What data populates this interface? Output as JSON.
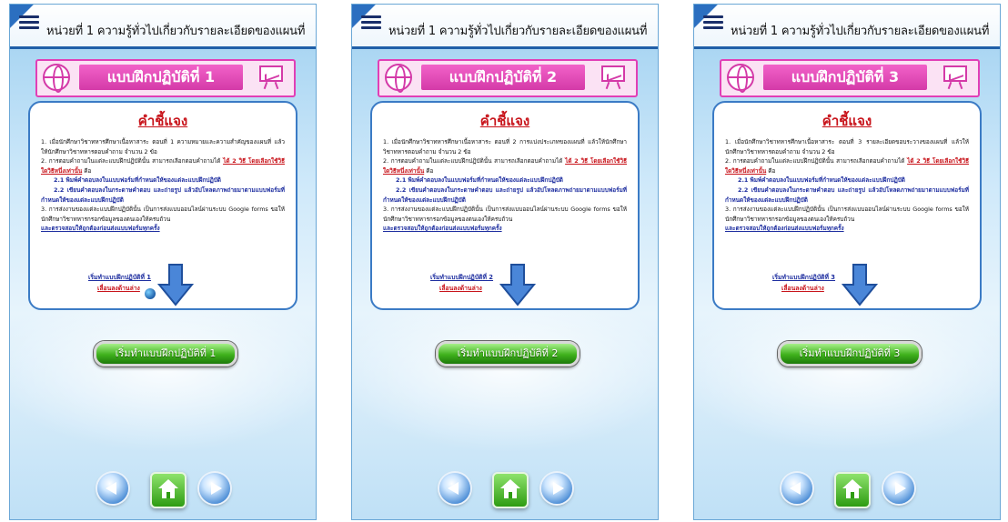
{
  "screens": [
    {
      "unit_title": "หน่วยที่ 1 ความรู้ทั่วไปเกี่ยวกับรายละเอียดของแผนที่",
      "exercise_title": "แบบฝึกปฏิบัติที่ 1",
      "heading": "คำชี้แจง",
      "para1": "1. เมื่อนักศึกษาวิชาทหารศึกษาเนื้อหาสาระ ตอนที่ 1 ความหมายและความสำคัญของแผนที่ แล้วให้นักศึกษาวิชาทหารตอบคำถาม จำนวน 2 ข้อ",
      "para2_pre": "2. การตอบคำถามในแต่ละแบบฝึกปฏิบัตินั้น สามารถเลือกตอบคำถามได้",
      "para2_red": "ได้ 2 วิธี โดยเลือกใช้วิธีใดวิธีหนึ่งเท่านั้น",
      "para2_post": "คือ",
      "item21": "2.1 พิมพ์คำตอบลงในแบบฟอร์มที่กำหนดให้ของแต่ละแบบฝึกปฏิบัติ",
      "item22": "2.2 เขียนคำตอบลงในกระดาษคำตอบ และถ่ายรูป แล้วอัปโหลดภาพถ่ายมาตามแบบฟอร์มที่กำหนดให้ของแต่ละแบบฝึกปฏิบัติ",
      "para3": "3. การส่งงานของแต่ละแบบฝึกปฏิบัตินั้น เป็นการส่งแบบออนไลน์ผ่านระบบ Google forms ขอให้นักศึกษาวิชาทหารกรอกข้อมูลของตนเองให้ครบถ้วน",
      "para3_tail": "และตรวจสอบให้ถูกต้องก่อนส่งแบบฟอร์มทุกครั้ง",
      "start_link": "เริ่มทำแบบฝึกปฏิบัติที่ 1",
      "scroll_hint": "เลื่อนลงด้านล่าง",
      "start_button": "เริ่มทำแบบฝึกปฏิบัติที่ 1"
    },
    {
      "unit_title": "หน่วยที่ 1 ความรู้ทั่วไปเกี่ยวกับรายละเอียดของแผนที่",
      "exercise_title": "แบบฝึกปฏิบัติที่ 2",
      "heading": "คำชี้แจง",
      "para1": "1. เมื่อนักศึกษาวิชาทหารศึกษาเนื้อหาสาระ ตอนที่ 2 การแบ่งประเภทของแผนที่ แล้วให้นักศึกษาวิชาทหารตอบคำถาม จำนวน 2 ข้อ",
      "para2_pre": "2. การตอบคำถามในแต่ละแบบฝึกปฏิบัตินั้น สามารถเลือกตอบคำถามได้",
      "para2_red": "ได้ 2 วิธี โดยเลือกใช้วิธีใดวิธีหนึ่งเท่านั้น",
      "para2_post": "คือ",
      "item21": "2.1 พิมพ์คำตอบลงในแบบฟอร์มที่กำหนดให้ของแต่ละแบบฝึกปฏิบัติ",
      "item22": "2.2 เขียนคำตอบลงในกระดาษคำตอบ และถ่ายรูป แล้วอัปโหลดภาพถ่ายมาตามแบบฟอร์มที่กำหนดให้ของแต่ละแบบฝึกปฏิบัติ",
      "para3": "3. การส่งงานของแต่ละแบบฝึกปฏิบัตินั้น เป็นการส่งแบบออนไลน์ผ่านระบบ Google forms ขอให้นักศึกษาวิชาทหารกรอกข้อมูลของตนเองให้ครบถ้วน",
      "para3_tail": "และตรวจสอบให้ถูกต้องก่อนส่งแบบฟอร์มทุกครั้ง",
      "start_link": "เริ่มทำแบบฝึกปฏิบัติที่ 2",
      "scroll_hint": "เลื่อนลงด้านล่าง",
      "start_button": "เริ่มทำแบบฝึกปฏิบัติที่ 2"
    },
    {
      "unit_title": "หน่วยที่ 1 ความรู้ทั่วไปเกี่ยวกับรายละเอียดของแผนที่",
      "exercise_title": "แบบฝึกปฏิบัติที่ 3",
      "heading": "คำชี้แจง",
      "para1": "1. เมื่อนักศึกษาวิชาทหารศึกษาเนื้อหาสาระ ตอนที่ 3 รายละเอียดขอบระวางของแผนที่ แล้วให้นักศึกษาวิชาทหารตอบคำถาม จำนวน 2 ข้อ",
      "para2_pre": "2. การตอบคำถามในแต่ละแบบฝึกปฏิบัตินั้น สามารถเลือกตอบคำถามได้",
      "para2_red": "ได้ 2 วิธี โดยเลือกใช้วิธีใดวิธีหนึ่งเท่านั้น",
      "para2_post": "คือ",
      "item21": "2.1 พิมพ์คำตอบลงในแบบฟอร์มที่กำหนดให้ของแต่ละแบบฝึกปฏิบัติ",
      "item22": "2.2 เขียนคำตอบลงในกระดาษคำตอบ และถ่ายรูป แล้วอัปโหลดภาพถ่ายมาตามแบบฟอร์มที่กำหนดให้ของแต่ละแบบฝึกปฏิบัติ",
      "para3": "3. การส่งงานของแต่ละแบบฝึกปฏิบัตินั้น เป็นการส่งแบบออนไลน์ผ่านระบบ Google forms ขอให้นักศึกษาวิชาทหารกรอกข้อมูลของตนเองให้ครบถ้วน",
      "para3_tail": "และตรวจสอบให้ถูกต้องก่อนส่งแบบฟอร์มทุกครั้ง",
      "start_link": "เริ่มทำแบบฝึกปฏิบัติที่ 3",
      "scroll_hint": "เลื่อนลงด้านล่าง",
      "start_button": "เริ่มทำแบบฝึกปฏิบัติที่ 3"
    }
  ],
  "icons": {
    "menu": "hamburger-icon",
    "globe": "globe-icon",
    "board": "presentation-board-icon",
    "arrow": "down-arrow-icon",
    "prev": "previous-icon",
    "home": "home-icon",
    "next": "next-icon"
  },
  "colors": {
    "accent_magenta": "#d43aa8",
    "heading_red": "#c8141b",
    "link_blue": "#1f2fa0",
    "button_green": "#3fb11c",
    "nav_blue": "#4d8ed6"
  }
}
